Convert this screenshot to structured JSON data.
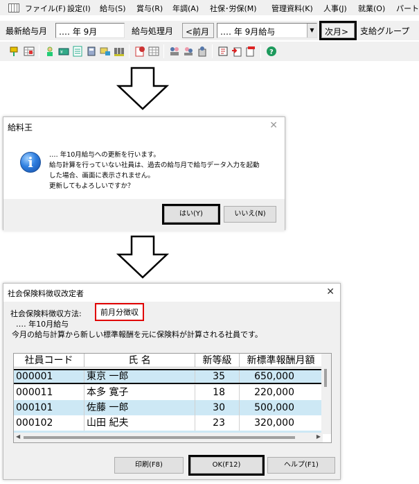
{
  "menubar": {
    "items": [
      "ファイル(F)",
      "設定(I)",
      "給与(S)",
      "賞与(R)",
      "年調(A)",
      "社保･労保(M)",
      "管理資料(K)",
      "人事(J)",
      "就業(O)",
      "パート"
    ]
  },
  "toolbar1": {
    "latest_label": "最新給与月",
    "latest_value": "‥‥ 年  9月",
    "processing_label": "給与処理月",
    "prev_button": "<前月",
    "processing_value": "‥‥ 年  9月給与",
    "next_button": "次月>",
    "group_label": "支給グループ"
  },
  "dialog1": {
    "title": "給料王",
    "message_lines": [
      "‥‥ 年10月給与への更新を行います。",
      "給与計算を行っていない社員は、過去の給与月で給与データ入力を起動",
      "した場合、画面に表示されません。",
      "更新してもよろしいですか？"
    ],
    "yes_button": "はい(Y)",
    "no_button": "いいえ(N)"
  },
  "dialog2": {
    "title": "社会保険料徴収改定者",
    "method_label": "社会保険料徴収方法:",
    "method_value": "前月分徴収",
    "month_line": "‥‥ 年10月給与",
    "description": "今月の給与計算から新しい標準報酬を元に保険料が計算される社員です。",
    "columns": [
      "社員コード",
      "氏  名",
      "新等級",
      "新標準報酬月額"
    ],
    "rows": [
      {
        "code": "000001",
        "name": "東京  一郎",
        "grade": "35",
        "amount": "650,000"
      },
      {
        "code": "000011",
        "name": "本多  寛子",
        "grade": "18",
        "amount": "220,000"
      },
      {
        "code": "000101",
        "name": "佐藤  一郎",
        "grade": "30",
        "amount": "500,000"
      },
      {
        "code": "000102",
        "name": "山田  紀夫",
        "grade": "23",
        "amount": "320,000"
      }
    ],
    "print_button": "印刷(F8)",
    "ok_button": "OK(F12)",
    "help_button": "ヘルプ(F1)"
  },
  "colors": {
    "row_highlight": "#cde8f5",
    "selected_row_border": "#000000",
    "red_box": "#e00000"
  }
}
